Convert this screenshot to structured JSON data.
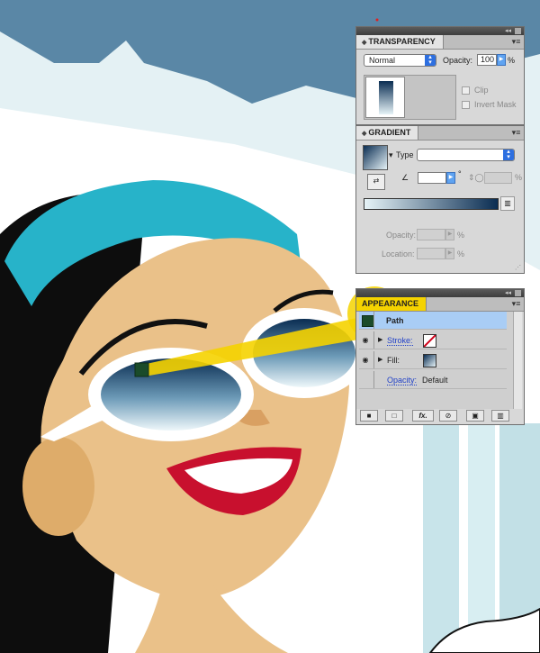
{
  "transparency": {
    "title": "TRANSPARENCY",
    "blend_mode": "Normal",
    "opacity_label": "Opacity:",
    "opacity_value": "100",
    "opacity_unit": "%",
    "clip_label": "Clip",
    "invert_mask_label": "Invert Mask"
  },
  "gradient": {
    "title": "GRADIENT",
    "type_label": "Type",
    "type_value": "",
    "angle_value": "",
    "angle_unit": "°",
    "aspect_unit": "%",
    "opacity_label": "Opacity:",
    "opacity_unit": "%",
    "location_label": "Location:",
    "location_unit": "%",
    "colors": {
      "start": "#e6f3f7",
      "end": "#0a2d52"
    }
  },
  "appearance": {
    "title": "APPEARANCE",
    "path_label": "Path",
    "stroke_label": "Stroke:",
    "fill_label": "Fill:",
    "opacity_label": "Opacity:",
    "opacity_value": "Default",
    "bottom_icons": [
      "new-art-icon",
      "clear-appearance-icon",
      "fx-icon",
      "delete-icon",
      "duplicate-icon",
      "trash-icon"
    ]
  },
  "colors": {
    "sky": "#5a87a6",
    "highlight": "#f5d300",
    "headband": "#27b3c9",
    "skin": "#eac189",
    "lips": "#c8102e"
  }
}
